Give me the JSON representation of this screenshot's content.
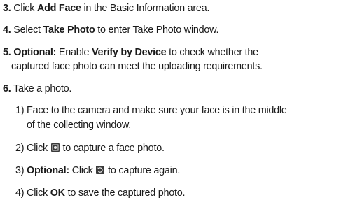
{
  "steps": [
    {
      "num": "3.",
      "pre": " Click ",
      "bold": "Add Face",
      "post": " in the Basic Information area."
    },
    {
      "num": "4.",
      "pre": " Select ",
      "bold": "Take Photo",
      "post": " to enter Take Photo window."
    },
    {
      "num": "5.",
      "optional": "Optional:",
      "pre": " Enable ",
      "bold": "Verify by Device",
      "post": " to check whether the",
      "line2": "captured face photo can meet the uploading requirements."
    },
    {
      "num": "6.",
      "text": " Take a photo."
    }
  ],
  "substeps": [
    {
      "num": "1)",
      "line1": " Face to the camera and make sure your face is in the middle",
      "line2": "of the collecting window."
    },
    {
      "num": "2)",
      "pre": " Click ",
      "post": " to capture a face photo.",
      "icon": "capture-icon"
    },
    {
      "num": "3)",
      "optional": "Optional:",
      "pre": " Click ",
      "post": " to capture again.",
      "icon": "recapture-icon"
    },
    {
      "num": "4)",
      "pre": " Click ",
      "bold": "OK",
      "post": " to save the captured photo."
    }
  ]
}
